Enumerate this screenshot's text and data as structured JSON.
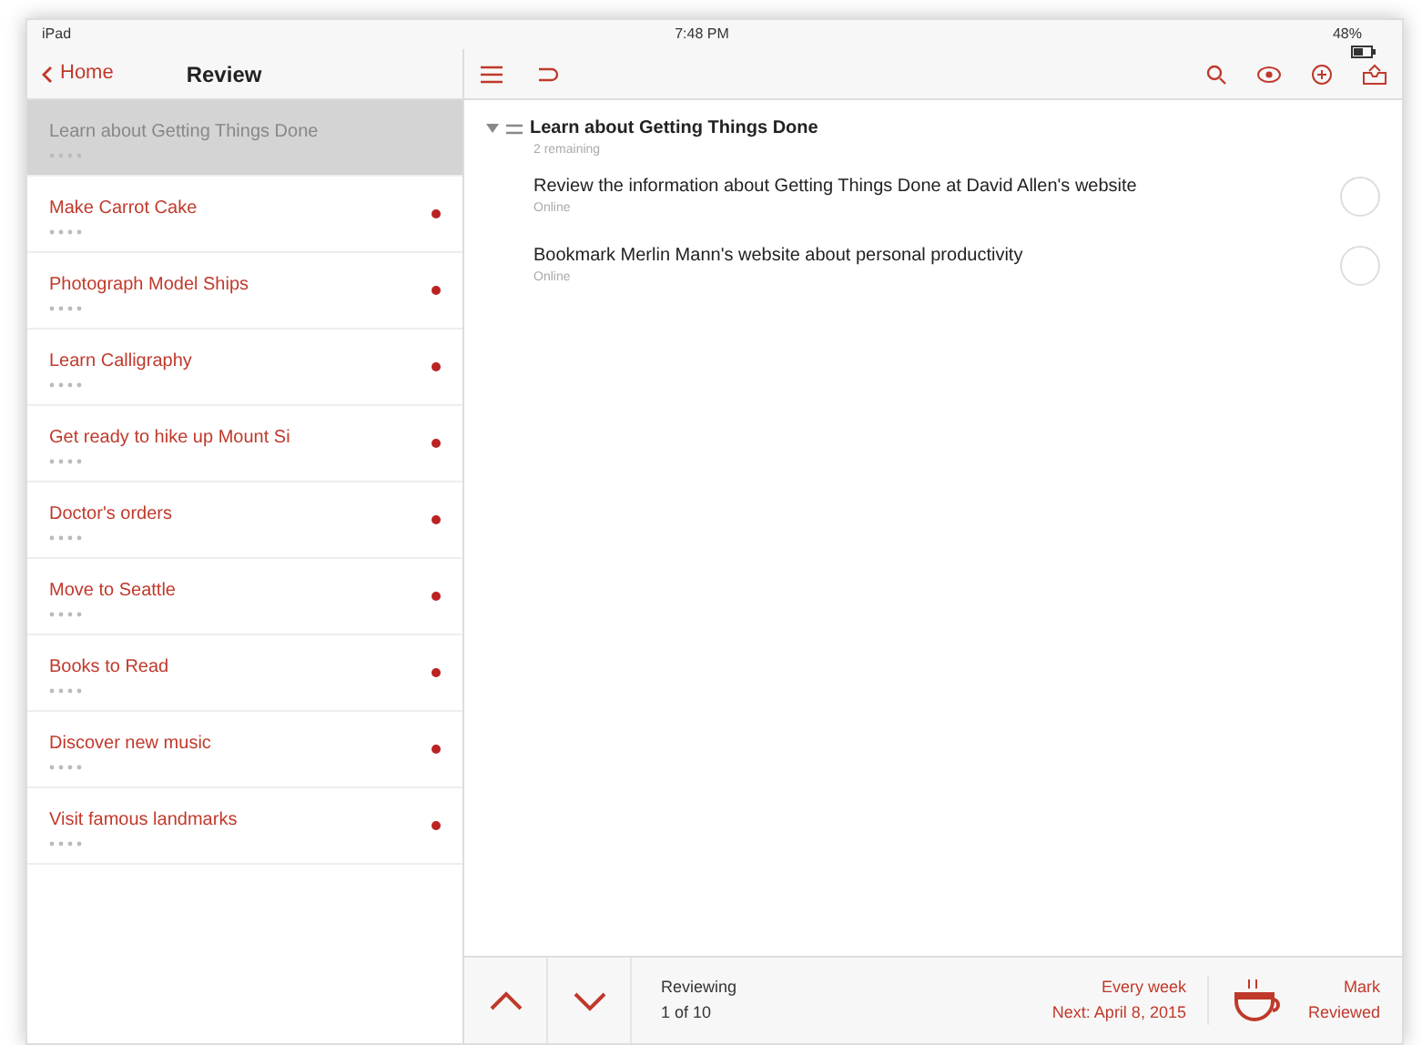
{
  "status_bar": {
    "carrier": "iPad",
    "time": "7:48 PM",
    "battery": "48%"
  },
  "sidebar": {
    "back": "Home",
    "title": "Review",
    "items": [
      {
        "title": "Learn about Getting Things Done",
        "selected": true,
        "flagged": false
      },
      {
        "title": "Make Carrot Cake",
        "selected": false,
        "flagged": true
      },
      {
        "title": "Photograph Model Ships",
        "selected": false,
        "flagged": true
      },
      {
        "title": "Learn Calligraphy",
        "selected": false,
        "flagged": true
      },
      {
        "title": "Get ready to hike up Mount Si",
        "selected": false,
        "flagged": true
      },
      {
        "title": "Doctor's orders",
        "selected": false,
        "flagged": true
      },
      {
        "title": "Move to Seattle",
        "selected": false,
        "flagged": true
      },
      {
        "title": "Books to Read",
        "selected": false,
        "flagged": true
      },
      {
        "title": "Discover new music",
        "selected": false,
        "flagged": true
      },
      {
        "title": "Visit famous landmarks",
        "selected": false,
        "flagged": true
      }
    ]
  },
  "project": {
    "title": "Learn about Getting Things Done",
    "expanded": true,
    "subtitle": "2 remaining",
    "tasks": [
      {
        "title": "Review the information about Getting Things Done at David Allen's website",
        "context": "Online",
        "checked": false
      },
      {
        "title": "Bookmark Merlin Mann's website about personal productivity",
        "context": "Online",
        "checked": false
      }
    ]
  },
  "footer": {
    "reviewing": "Reviewing",
    "position": "1 of 10",
    "interval": "Every week",
    "next": "Next: April 8, 2015",
    "mark": "Mark",
    "reviewed": "Reviewed"
  }
}
